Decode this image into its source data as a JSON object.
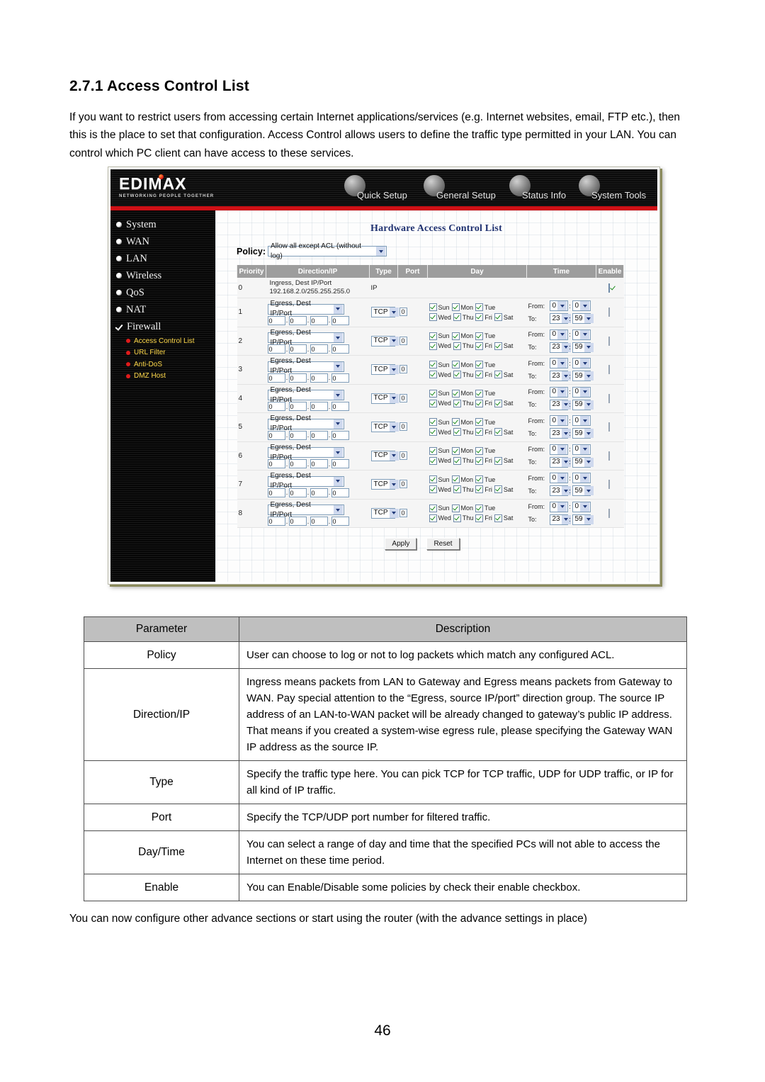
{
  "document": {
    "heading": "2.7.1 Access Control List",
    "intro": "If you want to restrict users from accessing certain Internet applications/services (e.g. Internet websites, email, FTP etc.), then this is the place to set that configuration. Access Control allows users to define the traffic type permitted in your LAN. You can control which PC client can have access to these services.",
    "footnote": "You can now configure other advance sections or start using the router (with the advance settings in place)",
    "page_number": "46"
  },
  "router_ui": {
    "brand": {
      "name": "EDIMAX",
      "tagline": "NETWORKING PEOPLE TOGETHER"
    },
    "nav": [
      {
        "label": "Quick Setup",
        "icon": "mouse-icon"
      },
      {
        "label": "General Setup",
        "icon": "globe-icon"
      },
      {
        "label": "Status Info",
        "icon": "chart-icon"
      },
      {
        "label": "System Tools",
        "icon": "tools-icon"
      }
    ],
    "sidebar": {
      "items": [
        {
          "label": "System",
          "marker": "bullet"
        },
        {
          "label": "WAN",
          "marker": "bullet"
        },
        {
          "label": "LAN",
          "marker": "bullet"
        },
        {
          "label": "Wireless",
          "marker": "bullet"
        },
        {
          "label": "QoS",
          "marker": "bullet"
        },
        {
          "label": "NAT",
          "marker": "bullet"
        },
        {
          "label": "Firewall",
          "marker": "check"
        }
      ],
      "sub_items": [
        {
          "label": "Access Control List"
        },
        {
          "label": "URL Filter"
        },
        {
          "label": "Anti-DoS"
        },
        {
          "label": "DMZ Host"
        }
      ]
    },
    "panel": {
      "title": "Hardware Access Control List",
      "policy_label": "Policy:",
      "policy_value": "Allow all except ACL (without log)",
      "table": {
        "headers": [
          "Priority",
          "Direction/IP",
          "Type",
          "Port",
          "Day",
          "Time",
          "Enable"
        ],
        "static_row": {
          "priority": "0",
          "direction_line1": "Ingress, Dest IP/Port",
          "direction_line2": "192.168.2.0/255.255.255.0",
          "type": "IP",
          "port": "",
          "enabled": true
        },
        "editable_rows": [
          {
            "priority": "1",
            "direction": "Egress, Dest IP/Port",
            "ip": [
              "0",
              "0",
              "0",
              "0"
            ],
            "type": "TCP",
            "port": "0",
            "days_checked": true,
            "from_h": "0",
            "from_m": "0",
            "to_h": "23",
            "to_m": "59",
            "enabled": false
          },
          {
            "priority": "2",
            "direction": "Egress, Dest IP/Port",
            "ip": [
              "0",
              "0",
              "0",
              "0"
            ],
            "type": "TCP",
            "port": "0",
            "days_checked": true,
            "from_h": "0",
            "from_m": "0",
            "to_h": "23",
            "to_m": "59",
            "enabled": false
          },
          {
            "priority": "3",
            "direction": "Egress, Dest IP/Port",
            "ip": [
              "0",
              "0",
              "0",
              "0"
            ],
            "type": "TCP",
            "port": "0",
            "days_checked": true,
            "from_h": "0",
            "from_m": "0",
            "to_h": "23",
            "to_m": "59",
            "enabled": false
          },
          {
            "priority": "4",
            "direction": "Egress, Dest IP/Port",
            "ip": [
              "0",
              "0",
              "0",
              "0"
            ],
            "type": "TCP",
            "port": "0",
            "days_checked": true,
            "from_h": "0",
            "from_m": "0",
            "to_h": "23",
            "to_m": "59",
            "enabled": false
          },
          {
            "priority": "5",
            "direction": "Egress, Dest IP/Port",
            "ip": [
              "0",
              "0",
              "0",
              "0"
            ],
            "type": "TCP",
            "port": "0",
            "days_checked": true,
            "from_h": "0",
            "from_m": "0",
            "to_h": "23",
            "to_m": "59",
            "enabled": false
          },
          {
            "priority": "6",
            "direction": "Egress, Dest IP/Port",
            "ip": [
              "0",
              "0",
              "0",
              "0"
            ],
            "type": "TCP",
            "port": "0",
            "days_checked": true,
            "from_h": "0",
            "from_m": "0",
            "to_h": "23",
            "to_m": "59",
            "enabled": false
          },
          {
            "priority": "7",
            "direction": "Egress, Dest IP/Port",
            "ip": [
              "0",
              "0",
              "0",
              "0"
            ],
            "type": "TCP",
            "port": "0",
            "days_checked": true,
            "from_h": "0",
            "from_m": "0",
            "to_h": "23",
            "to_m": "59",
            "enabled": false
          },
          {
            "priority": "8",
            "direction": "Egress, Dest IP/Port",
            "ip": [
              "0",
              "0",
              "0",
              "0"
            ],
            "type": "TCP",
            "port": "0",
            "days_checked": true,
            "from_h": "0",
            "from_m": "0",
            "to_h": "23",
            "to_m": "59",
            "enabled": false
          }
        ],
        "day_labels_row1": [
          "Sun",
          "Mon",
          "Tue"
        ],
        "day_labels_row2": [
          "Wed",
          "Thu",
          "Fri",
          "Sat"
        ],
        "time_from_label": "From:",
        "time_to_label": "To:"
      },
      "buttons": {
        "apply": "Apply",
        "reset": "Reset"
      }
    }
  },
  "param_table": {
    "headers": [
      "Parameter",
      "Description"
    ],
    "rows": [
      {
        "parameter": "Policy",
        "description": "User can choose to log or not to log packets which match any configured ACL."
      },
      {
        "parameter": "Direction/IP",
        "description": "Ingress means packets from LAN to Gateway and Egress means packets from Gateway to WAN. Pay special attention to the “Egress, source IP/port” direction group. The source IP address of an LAN-to-WAN packet will be already changed to gateway’s public IP address. That means if you created a system-wise egress rule, please specifying the Gateway WAN IP address as the source IP."
      },
      {
        "parameter": "Type",
        "description": "Specify the traffic type here. You can pick TCP for TCP traffic, UDP for UDP traffic, or IP for all kind of IP traffic."
      },
      {
        "parameter": "Port",
        "description": "Specify the TCP/UDP port number for filtered traffic."
      },
      {
        "parameter": "Day/Time",
        "description": "You can select a range of day and time that the specified PCs will not able to access the Internet on these time period."
      },
      {
        "parameter": "Enable",
        "description": "You can Enable/Disable some policies by check their enable checkbox."
      }
    ]
  },
  "colors": {
    "brand_red": "#cf1016",
    "title_blue": "#1f3170",
    "submenu_yellow": "#ffd94a",
    "table_header_gray": "#9d9d9d"
  }
}
